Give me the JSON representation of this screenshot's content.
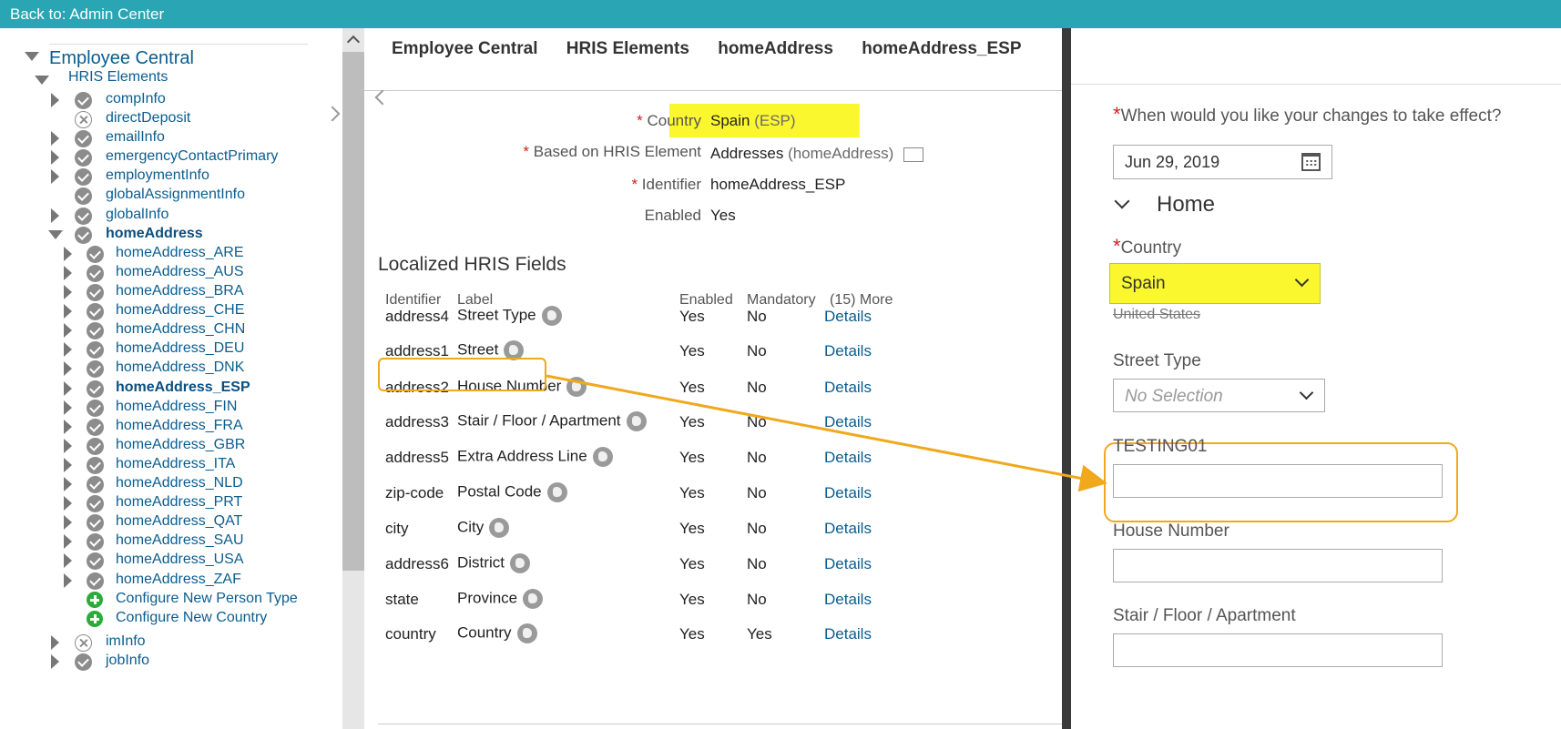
{
  "topbar": {
    "back_label": "Back to: Admin Center"
  },
  "sidebar": {
    "title": "Employee Central",
    "hris": "HRIS Elements",
    "items": [
      {
        "label": "compInfo",
        "icon": "check",
        "expand": true
      },
      {
        "label": "directDeposit",
        "icon": "x",
        "expand": false
      },
      {
        "label": "emailInfo",
        "icon": "check",
        "expand": true
      },
      {
        "label": "emergencyContactPrimary",
        "icon": "check",
        "expand": true
      },
      {
        "label": "employmentInfo",
        "icon": "check",
        "expand": true
      },
      {
        "label": "globalAssignmentInfo",
        "icon": "check",
        "expand": false
      },
      {
        "label": "globalInfo",
        "icon": "check",
        "expand": true
      },
      {
        "label": "homeAddress",
        "icon": "check",
        "expand": "open",
        "bold": true
      }
    ],
    "sub_items": [
      "homeAddress_ARE",
      "homeAddress_AUS",
      "homeAddress_BRA",
      "homeAddress_CHE",
      "homeAddress_CHN",
      "homeAddress_DEU",
      "homeAddress_DNK",
      "homeAddress_ESP",
      "homeAddress_FIN",
      "homeAddress_FRA",
      "homeAddress_GBR",
      "homeAddress_ITA",
      "homeAddress_NLD",
      "homeAddress_PRT",
      "homeAddress_QAT",
      "homeAddress_SAU",
      "homeAddress_USA",
      "homeAddress_ZAF"
    ],
    "selected_sub": "homeAddress_ESP",
    "config_person": "Configure New Person Type",
    "config_country": "Configure New Country",
    "after_items": [
      {
        "label": "imInfo",
        "icon": "x"
      },
      {
        "label": "jobInfo",
        "icon": "check"
      }
    ]
  },
  "main": {
    "breadcrumbs": [
      "Employee Central",
      "HRIS Elements",
      "homeAddress",
      "homeAddress_ESP"
    ],
    "country_label": "Country",
    "country_value": "Spain",
    "country_code": "(ESP)",
    "based_label": "Based on HRIS Element",
    "based_value": "Addresses",
    "based_sub": "(homeAddress)",
    "identifier_label": "Identifier",
    "identifier_value": "homeAddress_ESP",
    "enabled_label": "Enabled",
    "enabled_value": "Yes",
    "section_title": "Localized HRIS Fields",
    "columns": [
      "Identifier",
      "Label",
      "Enabled",
      "Mandatory",
      "(15) More"
    ],
    "rows": [
      {
        "id": "address4",
        "label": "Street Type",
        "enabled": "Yes",
        "mandatory": "No",
        "link": "Details"
      },
      {
        "id": "address1",
        "label": "Street",
        "enabled": "Yes",
        "mandatory": "No",
        "link": "Details"
      },
      {
        "id": "address2",
        "label": "House Number",
        "enabled": "Yes",
        "mandatory": "No",
        "link": "Details"
      },
      {
        "id": "address3",
        "label": "Stair / Floor / Apartment",
        "enabled": "Yes",
        "mandatory": "No",
        "link": "Details"
      },
      {
        "id": "address5",
        "label": "Extra Address Line",
        "enabled": "Yes",
        "mandatory": "No",
        "link": "Details"
      },
      {
        "id": "zip-code",
        "label": "Postal Code",
        "enabled": "Yes",
        "mandatory": "No",
        "link": "Details"
      },
      {
        "id": "city",
        "label": "City",
        "enabled": "Yes",
        "mandatory": "No",
        "link": "Details"
      },
      {
        "id": "address6",
        "label": "District",
        "enabled": "Yes",
        "mandatory": "No",
        "link": "Details"
      },
      {
        "id": "state",
        "label": "Province",
        "enabled": "Yes",
        "mandatory": "No",
        "link": "Details"
      },
      {
        "id": "country",
        "label": "Country",
        "enabled": "Yes",
        "mandatory": "Yes",
        "link": "Details"
      }
    ]
  },
  "dialog": {
    "effect_label": "When would you like your changes to take effect?",
    "effect_date": "Jun 29, 2019",
    "home_title": "Home",
    "country_label": "Country",
    "country_value": "Spain",
    "country_old": "United States",
    "street_type_label": "Street Type",
    "street_type_value": "No Selection",
    "testing_label": "TESTING01",
    "house_label": "House Number",
    "stair_label": "Stair / Floor / Apartment"
  },
  "colors": {
    "accent": "#2aa5b3",
    "highlight": "#fbf72f",
    "callout": "#f0a81c",
    "link": "#0a5d8f"
  }
}
